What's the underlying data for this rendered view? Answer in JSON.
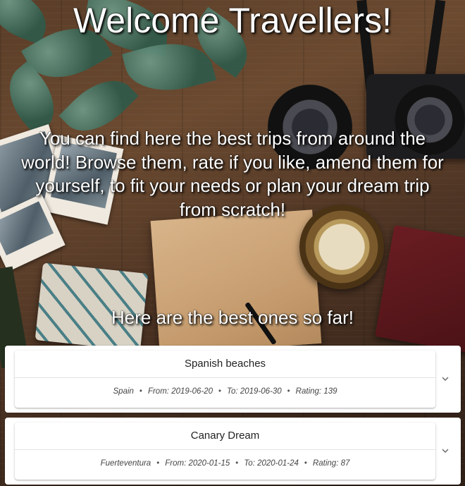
{
  "hero": {
    "title": "Welcome Travellers!",
    "intro": "You can find here the best trips from around the world! Browse them, rate if you like, amend them for yourself, to fit your needs or plan your dream trip from scratch!",
    "subtitle": "Here are the best ones so far!"
  },
  "trips": [
    {
      "name": "Spanish beaches",
      "place": "Spain",
      "from_label": "From:",
      "from": "2019-06-20",
      "to_label": "To:",
      "to": "2019-06-30",
      "rating_label": "Rating:",
      "rating": "139",
      "separator": "•",
      "expand_icon": "chevron-down-icon"
    },
    {
      "name": "Canary Dream",
      "place": "Fuerteventura",
      "from_label": "From:",
      "from": "2020-01-15",
      "to_label": "To:",
      "to": "2020-01-24",
      "rating_label": "Rating:",
      "rating": "87",
      "separator": "•",
      "expand_icon": "chevron-down-icon"
    }
  ],
  "colors": {
    "panel_bg": "#ffffff",
    "hero_text": "#ffffff",
    "meta_text": "#444444"
  }
}
